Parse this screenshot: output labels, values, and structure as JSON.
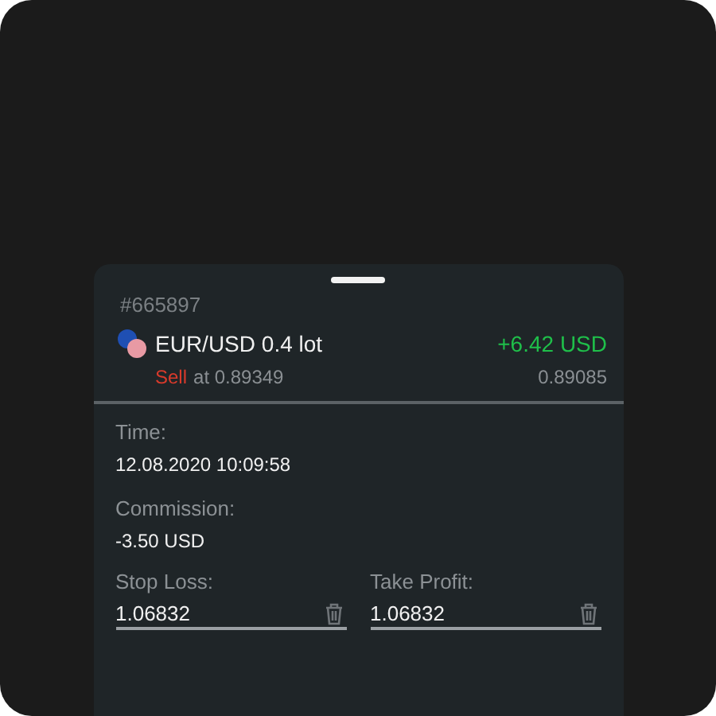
{
  "order": {
    "id": "#665897",
    "symbol": "EUR/USD",
    "volume": "0.4 lot",
    "profit": "+6.42 USD",
    "side": "Sell",
    "open_label": "at 0.89349",
    "current_price": "0.89085"
  },
  "details": [
    {
      "label": "Time:",
      "value": "12.08.2020 10:09:58"
    },
    {
      "label": "Commission:",
      "value": "-3.50 USD"
    }
  ],
  "fields": [
    {
      "label": "Stop Loss:",
      "value": "1.06832"
    },
    {
      "label": "Take Profit:",
      "value": "1.06832"
    }
  ]
}
